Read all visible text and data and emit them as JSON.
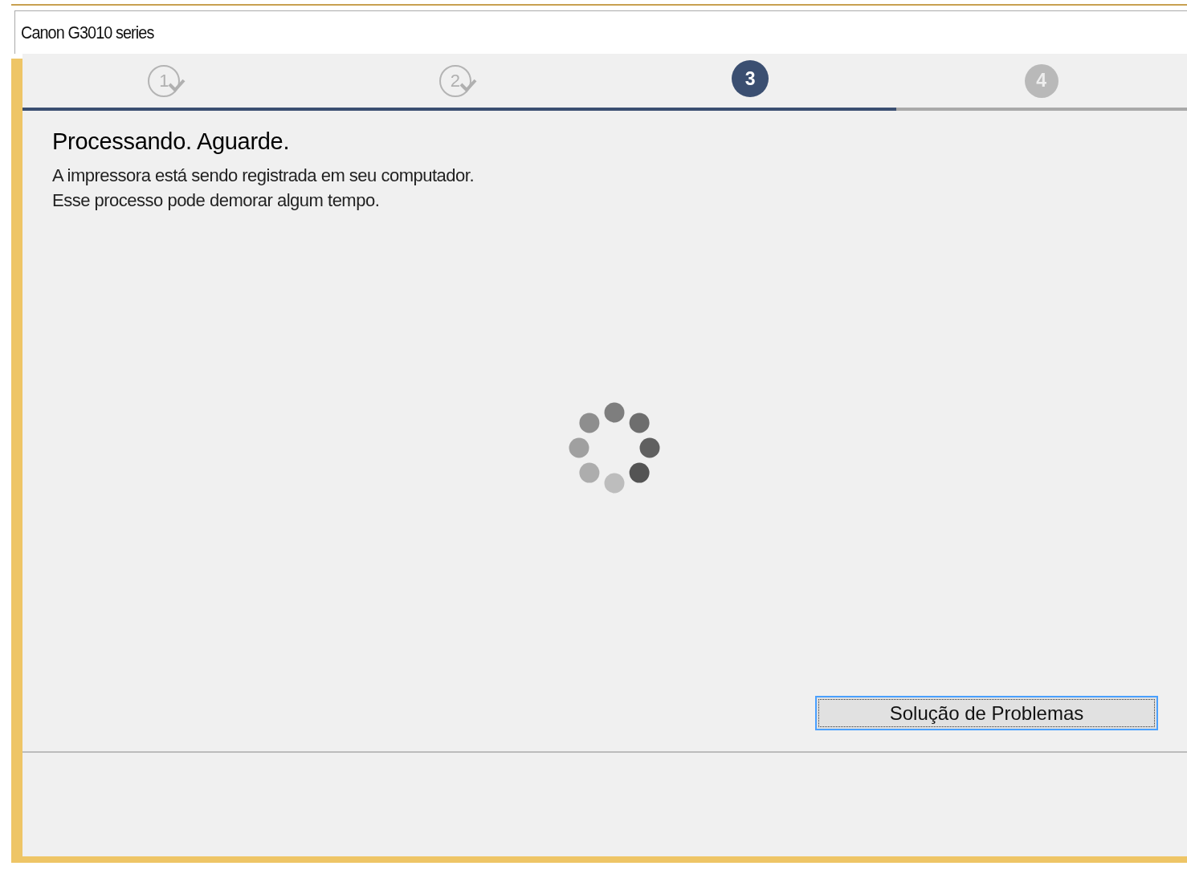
{
  "window": {
    "title": "Canon G3010 series"
  },
  "steps": [
    {
      "label": "1",
      "completed": true,
      "selected": false
    },
    {
      "label": "2",
      "completed": true,
      "selected": false
    },
    {
      "label": "3",
      "completed": false,
      "selected": true
    },
    {
      "label": "4",
      "completed": false,
      "selected": false
    }
  ],
  "progress": {
    "level": 0.75
  },
  "heading": "Processando. Aguarde.",
  "message": [
    "A impressora está sendo registrada em seu computador.",
    "Esse processo pode demorar algum tempo."
  ],
  "buttons": [
    {
      "label": "Solução de Problemas",
      "focused": true
    }
  ]
}
